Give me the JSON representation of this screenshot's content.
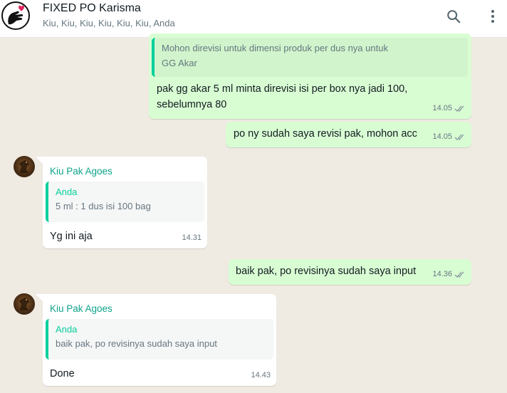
{
  "header": {
    "title": "FIXED PO Karisma",
    "participants": "Kiu, Kiu, Kiu, Kiu, Kiu, Kiu, Anda",
    "search_icon": "search-icon",
    "menu_icon": "more-vert-icon"
  },
  "messages": [
    {
      "direction": "out",
      "quote_text": "Mohon direvisi untuk dimensi produk per dus nya untuk GG Akar",
      "quote_line1": "Mohon direvisi untuk dimensi produk per dus nya untuk",
      "quote_line2": "GG Akar",
      "text_line1": "pak gg akar 5 ml minta direvisi isi per box nya jadi 100,",
      "text_line2": "sebelumnya 80",
      "time": "14.05",
      "status": "read"
    },
    {
      "direction": "out",
      "text": "po ny sudah saya revisi pak, mohon acc",
      "time": "14.05",
      "status": "read"
    },
    {
      "direction": "in",
      "sender": "Kiu Pak Agoes",
      "quote_name": "Anda",
      "quote_text": "5 ml : 1 dus isi 100 bag",
      "text": "Yg ini aja",
      "time": "14.31"
    },
    {
      "direction": "out",
      "text": "baik pak, po revisinya sudah saya input",
      "time": "14.36",
      "status": "read"
    },
    {
      "direction": "in",
      "sender": "Kiu Pak Agoes",
      "quote_name": "Anda",
      "quote_text": "baik pak, po revisinya sudah saya input",
      "text": "Done",
      "time": "14.43"
    }
  ],
  "colors": {
    "outgoing_bubble": "#d9fdd3",
    "incoming_bubble": "#ffffff",
    "chat_background": "#efeae2",
    "accent": "#06cf9c",
    "sender_name": "#0fa38a"
  }
}
